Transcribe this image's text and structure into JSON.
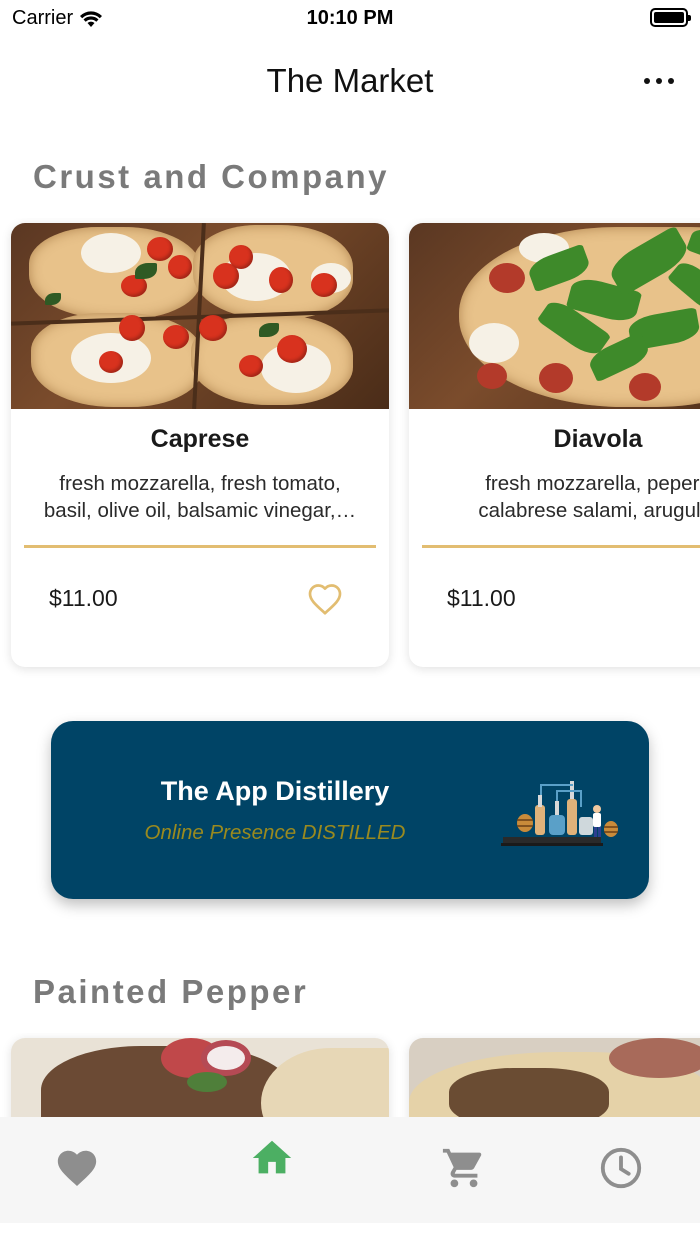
{
  "status_bar": {
    "carrier": "Carrier",
    "time": "10:10 PM"
  },
  "nav": {
    "title": "The Market",
    "more_icon": "more-horizontal-icon"
  },
  "sections": [
    {
      "title": "Crust and Company",
      "items": [
        {
          "name": "Caprese",
          "description": "fresh mozzarella, fresh tomato,\nbasil, olive oil, balsamic vinegar,…",
          "price": "$11.00",
          "favorite_icon": "heart-outline-icon"
        },
        {
          "name": "Diavola",
          "description": "fresh mozzarella, pepero\ncalabrese salami, arugula,",
          "price": "$11.00"
        }
      ]
    },
    {
      "title": "Painted Pepper"
    }
  ],
  "banner": {
    "title": "The App Distillery",
    "subtitle": "Online Presence DISTILLED"
  },
  "tab_bar": {
    "tabs": [
      {
        "icon": "heart-icon",
        "active": false
      },
      {
        "icon": "home-icon",
        "active": true
      },
      {
        "icon": "cart-icon",
        "active": false
      },
      {
        "icon": "clock-icon",
        "active": false
      }
    ]
  },
  "colors": {
    "accent_gold": "#e2bd71",
    "banner_bg": "#004466",
    "banner_subtitle": "#9a8a1f",
    "active_tab": "#4caf63",
    "inactive_tab": "#8e8e8e",
    "section_title": "#7a7a7a"
  }
}
